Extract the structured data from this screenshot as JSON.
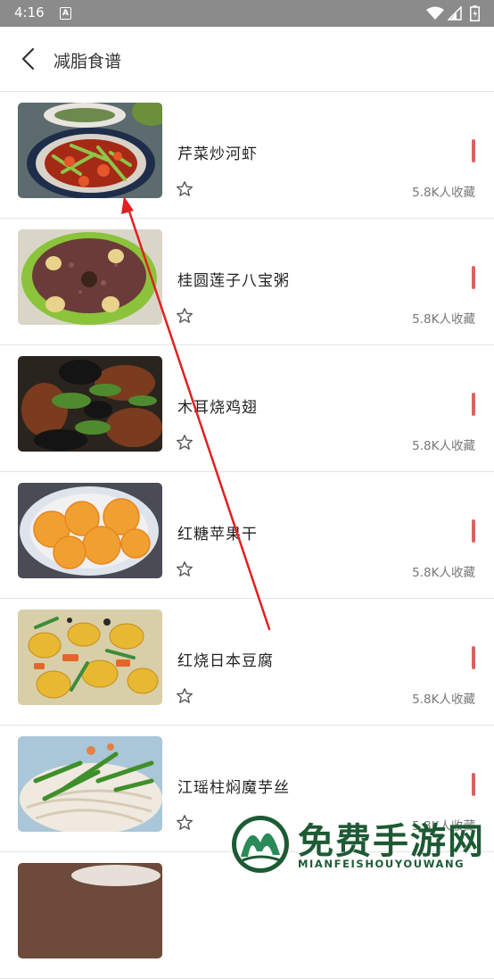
{
  "status_bar": {
    "time": "4:16",
    "notif_letter": "A"
  },
  "header": {
    "title": "减脂食谱"
  },
  "recipes": [
    {
      "name": "芹菜炒河虾",
      "favorites": "5.8K人收藏"
    },
    {
      "name": "桂圆莲子八宝粥",
      "favorites": "5.8K人收藏"
    },
    {
      "name": "木耳烧鸡翅",
      "favorites": "5.8K人收藏"
    },
    {
      "name": "红糖苹果干",
      "favorites": "5.8K人收藏"
    },
    {
      "name": "红烧日本豆腐",
      "favorites": "5.8K人收藏"
    },
    {
      "name": "江瑶柱焖魔芋丝",
      "favorites": "5.8K人收藏"
    }
  ],
  "watermark": {
    "title": "免费手游网",
    "subtitle": "MIANFEISHOUYOUWANG"
  },
  "colors": {
    "accent": "#e06060",
    "status_bar": "#8b8b8b",
    "arrow": "#e02020",
    "watermark": "#1d5a34"
  }
}
